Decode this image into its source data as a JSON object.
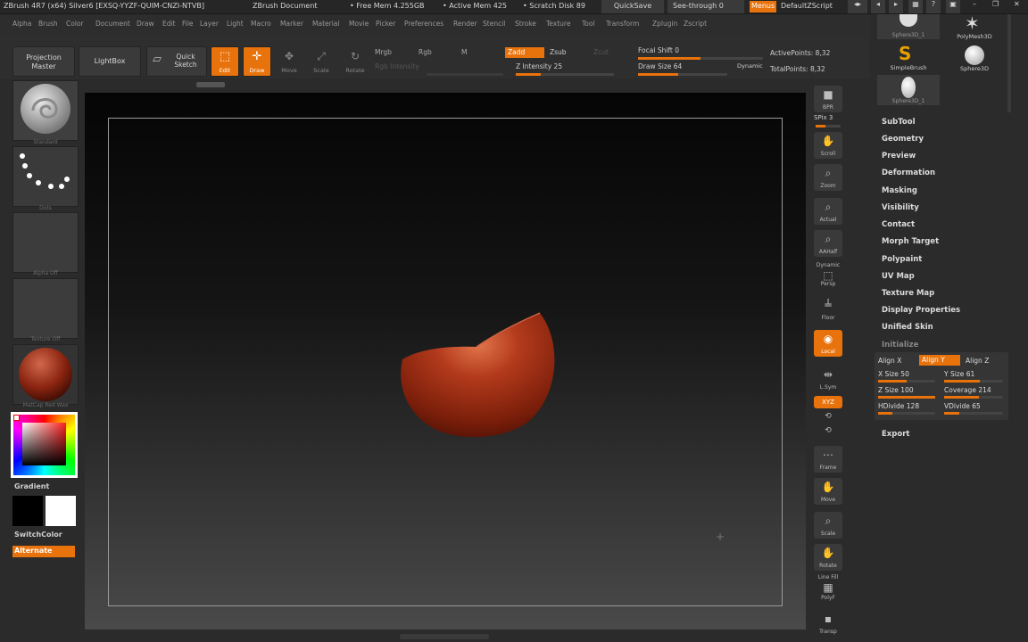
{
  "titlebar": {
    "app_title": "ZBrush 4R7 (x64) Silver6 [EXSQ-YYZF-QUIM-CNZI-NTVB]",
    "doc_title": "ZBrush Document",
    "free_mem": "• Free Mem 4.255GB",
    "active_mem": "• Active Mem 425",
    "scratch_disk": "• Scratch Disk 89",
    "quicksave": "QuickSave",
    "see_through": "See-through  0",
    "menus": "Menus",
    "script": "DefaultZScript"
  },
  "menus": [
    "Alpha",
    "Brush",
    "Color",
    "Document",
    "Draw",
    "Edit",
    "File",
    "Layer",
    "Light",
    "Macro",
    "Marker",
    "Material",
    "Movie",
    "Picker",
    "Preferences",
    "Render",
    "Stencil",
    "Stroke",
    "Texture",
    "Tool",
    "Transform",
    "Zplugin",
    "Zscript"
  ],
  "shelf": {
    "projection_master": "Projection Master",
    "lightbox": "LightBox",
    "quick_sketch": "Quick Sketch",
    "edit": "Edit",
    "draw": "Draw",
    "move": "Move",
    "scale": "Scale",
    "rotate": "Rotate",
    "mrgb": "Mrgb",
    "rgb": "Rgb",
    "m": "M",
    "rgb_intensity": "Rgb Intensity",
    "zadd": "Zadd",
    "zsub": "Zsub",
    "zcut": "Zcut",
    "z_intensity": "Z Intensity 25",
    "focal_shift": "Focal Shift 0",
    "draw_size": "Draw Size 64",
    "dynamic": "Dynamic",
    "active_points": "ActivePoints: 8,32",
    "total_points": "TotalPoints: 8,32",
    "z_intensity_level": 0.25,
    "focal_shift_level": 0.5,
    "draw_size_level": 0.45
  },
  "left": {
    "brush_caption": "Standard",
    "stroke_caption": "Dots",
    "alpha_caption": "Alpha Off",
    "texture_caption": "Texture Off",
    "material_caption": "MatCap Red Wax",
    "gradient": "Gradient",
    "switchcolor": "SwitchColor",
    "alternate": "Alternate"
  },
  "right_toolbar": {
    "bpr": "BPR",
    "spix": "SPix 3",
    "scroll": "Scroll",
    "zoom": "Zoom",
    "actual": "Actual",
    "aahalf": "AAHalf",
    "dynamic": "Dynamic",
    "persp": "Persp",
    "floor": "Floor",
    "local": "Local",
    "lsym": "L.Sym",
    "xyz": "XYZ",
    "frame": "Frame",
    "move": "Move",
    "scale": "Scale",
    "rotate": "Rotate",
    "linefill": "Line Fill",
    "polyf": "PolyF",
    "transp": "Transp"
  },
  "tool_panel": {
    "thumbs": [
      "Sphere3D_1",
      "PolyMesh3D",
      "SimpleBrush",
      "Sphere3D",
      "Sphere3D_1"
    ],
    "items": [
      "SubTool",
      "Geometry",
      "Preview",
      "Deformation",
      "Masking",
      "Visibility",
      "Contact",
      "Morph Target",
      "Polypaint",
      "UV Map",
      "Texture Map",
      "Display Properties",
      "Unified Skin"
    ],
    "initialize": "Initialize",
    "align_x": "Align X",
    "align_y": "Align Y",
    "align_z": "Align Z",
    "x_size": "X Size 50",
    "y_size": "Y Size 61",
    "z_size": "Z Size 100",
    "coverage": "Coverage 214",
    "hdivide": "HDivide 128",
    "vdivide": "VDivide 65",
    "export": "Export"
  },
  "colors": {
    "accent": "#e8720c",
    "wax": "#8a2410"
  }
}
